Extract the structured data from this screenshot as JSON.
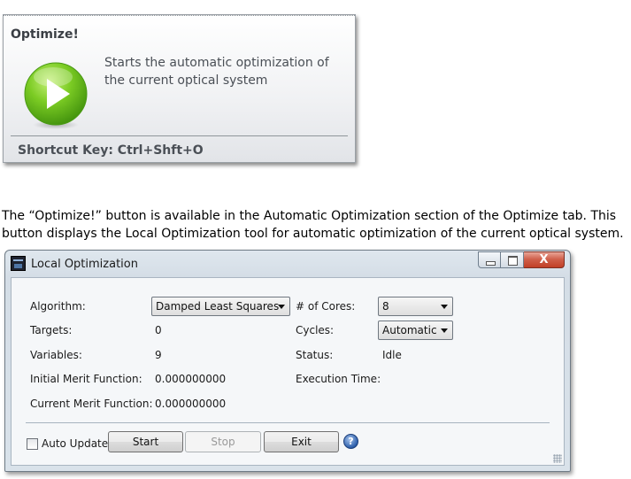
{
  "tooltip": {
    "title": "Optimize!",
    "description": "Starts the automatic optimization of the current optical system",
    "shortcut": "Shortcut Key: Ctrl+Shft+O",
    "icon": "play-icon",
    "accent": "#6cbf1f"
  },
  "caption": "The “Optimize!” button is available in the Automatic Optimization section of the Optimize tab. This button displays the Local Optimization tool for automatic optimization of the current optical system.",
  "window": {
    "title": "Local Optimization",
    "close_glyph": "X",
    "left": {
      "algorithm_label": "Algorithm:",
      "algorithm_value": "Damped Least Squares",
      "targets_label": "Targets:",
      "targets_value": "0",
      "variables_label": "Variables:",
      "variables_value": "9",
      "initial_mf_label": "Initial Merit Function:",
      "initial_mf_value": "0.000000000",
      "current_mf_label": "Current Merit Function:",
      "current_mf_value": "0.000000000"
    },
    "right": {
      "cores_label": "# of Cores:",
      "cores_value": "8",
      "cycles_label": "Cycles:",
      "cycles_value": "Automatic",
      "status_label": "Status:",
      "status_value": "Idle",
      "exec_label": "Execution Time:"
    },
    "footer": {
      "auto_update_label": "Auto Update",
      "auto_update_checked": false,
      "start_label": "Start",
      "stop_label": "Stop",
      "exit_label": "Exit",
      "help_glyph": "?"
    }
  }
}
